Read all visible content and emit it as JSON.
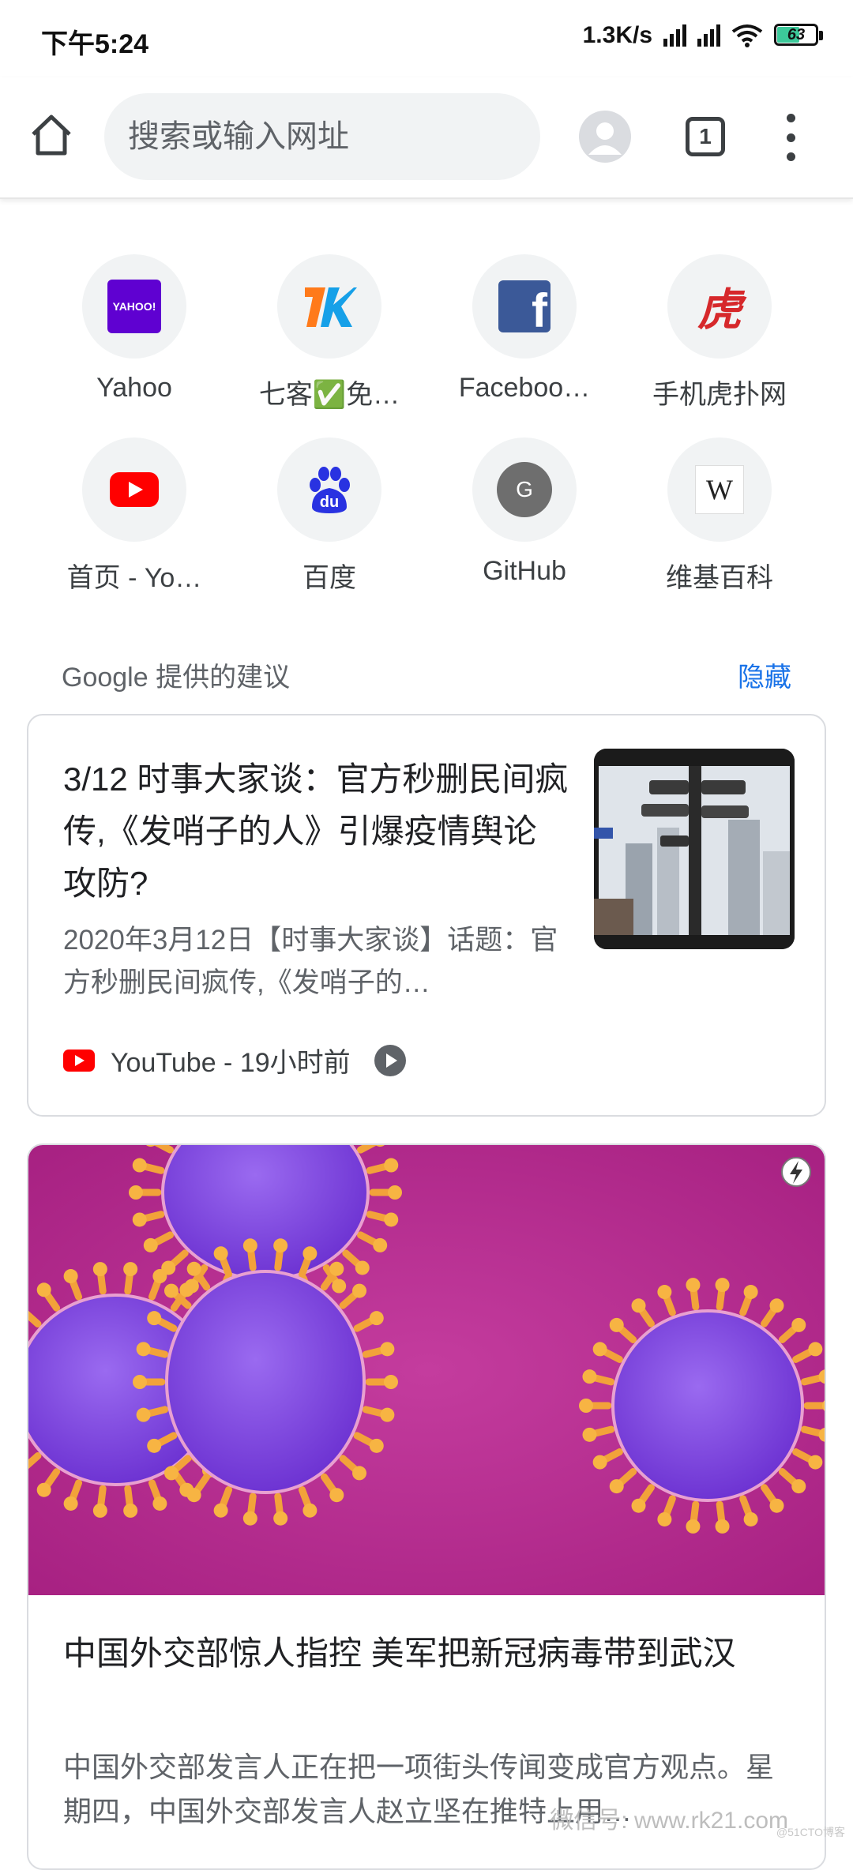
{
  "status_bar": {
    "time": "下午5:24",
    "net_speed": "1.3K/s",
    "battery_level": "63",
    "battery_fraction": 0.63
  },
  "toolbar": {
    "search_placeholder": "搜索或输入网址",
    "tab_count": "1"
  },
  "shortcuts": [
    {
      "label": "Yahoo",
      "icon": "yahoo-icon"
    },
    {
      "label": "七客✅免…",
      "icon": "qike-icon"
    },
    {
      "label": "Faceboo…",
      "icon": "facebook-icon"
    },
    {
      "label": "手机虎扑网",
      "icon": "hupu-icon"
    },
    {
      "label": "首页 - Yo…",
      "icon": "youtube-icon"
    },
    {
      "label": "百度",
      "icon": "baidu-icon"
    },
    {
      "label": "GitHub",
      "icon": "github-letter-icon"
    },
    {
      "label": "维基百科",
      "icon": "wikipedia-icon"
    }
  ],
  "suggestions": {
    "title": "Google 提供的建议",
    "hide_label": "隐藏"
  },
  "cards": [
    {
      "title": "3/12 时事大家谈：官方秒删民间疯传,《发哨子的人》引爆疫情舆论攻防?",
      "snippet": "2020年3月12日【时事大家谈】话题：官方秒删民间疯传,《发哨子的…",
      "source": "YouTube - 19小时前",
      "thumbnail": "surveillance-cameras-photo"
    },
    {
      "title": "中国外交部惊人指控 美军把新冠病毒带到武汉",
      "snippet": "中国外交部发言人正在把一项街头传闻变成官方观点。星期四，中国外交部发言人赵立坚在推特上用…",
      "image": "coronavirus-microscope-photo"
    }
  ],
  "watermark": "微信号: www.rk21.com",
  "watermark_small": "@51CTO博客",
  "colors": {
    "accent": "#1a73e8",
    "youtube_red": "#ff0000",
    "facebook_blue": "#3b5998",
    "yahoo_purple": "#5f01d1",
    "baidu_blue": "#2932e1",
    "hupu_red": "#d6282b",
    "virus_purple": "#8a4fe0",
    "virus_magenta": "#c2278f"
  }
}
